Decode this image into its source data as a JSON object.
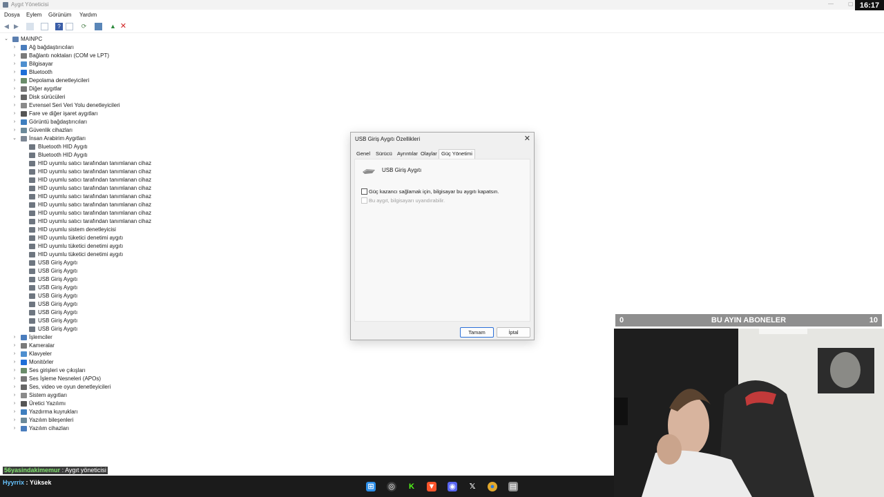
{
  "window": {
    "title": "Aygıt Yöneticisi",
    "clock": "16:17"
  },
  "menu": [
    "Dosya",
    "Eylem",
    "Görünüm",
    "Yardım"
  ],
  "tree": {
    "root": "MAINPC",
    "categories_before": [
      "Ağ bağdaştırıcıları",
      "Bağlantı noktaları (COM ve LPT)",
      "Bilgisayar",
      "Bluetooth",
      "Depolama denetleyicileri",
      "Diğer aygıtlar",
      "Disk sürücüleri",
      "Evrensel Seri Veri Yolu denetleyicileri",
      "Fare ve diğer işaret aygıtları",
      "Görüntü bağdaştırıcıları",
      "Güvenlik cihazları"
    ],
    "expanded_category": "İnsan Arabirim Aygıtları",
    "children": [
      "Bluetooth HID Aygıtı",
      "Bluetooth HID Aygıtı",
      "HID uyumlu satıcı tarafından tanımlanan cihaz",
      "HID uyumlu satıcı tarafından tanımlanan cihaz",
      "HID uyumlu satıcı tarafından tanımlanan cihaz",
      "HID uyumlu satıcı tarafından tanımlanan cihaz",
      "HID uyumlu satıcı tarafından tanımlanan cihaz",
      "HID uyumlu satıcı tarafından tanımlanan cihaz",
      "HID uyumlu satıcı tarafından tanımlanan cihaz",
      "HID uyumlu satıcı tarafından tanımlanan cihaz",
      "HID uyumlu sistem denetleyicisi",
      "HID uyumlu tüketici denetimi aygıtı",
      "HID uyumlu tüketici denetimi aygıtı",
      "HID uyumlu tüketici denetimi aygıtı",
      "USB Giriş Aygıtı",
      "USB Giriş Aygıtı",
      "USB Giriş Aygıtı",
      "USB Giriş Aygıtı",
      "USB Giriş Aygıtı",
      "USB Giriş Aygıtı",
      "USB Giriş Aygıtı",
      "USB Giriş Aygıtı",
      "USB Giriş Aygıtı"
    ],
    "categories_after": [
      "İşlemciler",
      "Kameralar",
      "Klavyeler",
      "Monitörler",
      "Ses girişleri ve çıkışları",
      "Ses İşleme Nesneleri (APOs)",
      "Ses, video ve oyun denetleyicileri",
      "Sistem aygıtları",
      "Üretici Yazılımı",
      "Yazdırma kuyrukları",
      "Yazılım bileşenleri",
      "Yazılım cihazları"
    ]
  },
  "dialog": {
    "title": "USB Giriş Aygıtı Özellikleri",
    "tabs": [
      "Genel",
      "Sürücü",
      "Ayrıntılar",
      "Olaylar",
      "Güç Yönetimi"
    ],
    "active_tab": "Güç Yönetimi",
    "device_name": "USB Giriş Aygıtı",
    "checkbox1": {
      "label": "Güç kazancı sağlamak için, bilgisayar bu aygıtı kapatsın.",
      "checked": false
    },
    "checkbox2": {
      "label": "Bu aygıt, bilgisayarı uyandırabilir.",
      "checked": false,
      "disabled": true
    },
    "ok_label": "Tamam",
    "cancel_label": "İptal"
  },
  "overlay": {
    "subscriber_left": "0",
    "subscriber_title": "BU AYIN ABONELER",
    "subscriber_right": "10",
    "chat": [
      {
        "user": "56yasindakimemur",
        "message": ": Aygıt yöneticisi"
      },
      {
        "user": "Hyyrrix",
        "message": ": Yüksek"
      }
    ]
  },
  "taskbar_icons": [
    "windows-start-icon",
    "steam-icon",
    "kick-icon",
    "brave-icon",
    "discord-icon",
    "x-icon",
    "chrome-icon",
    "device-manager-icon"
  ],
  "colors": {
    "accent": "#2a6fd8",
    "chat_user1": "#7ee06c",
    "chat_user2": "#67c4ff",
    "taskbar": "#1b1b1b"
  }
}
